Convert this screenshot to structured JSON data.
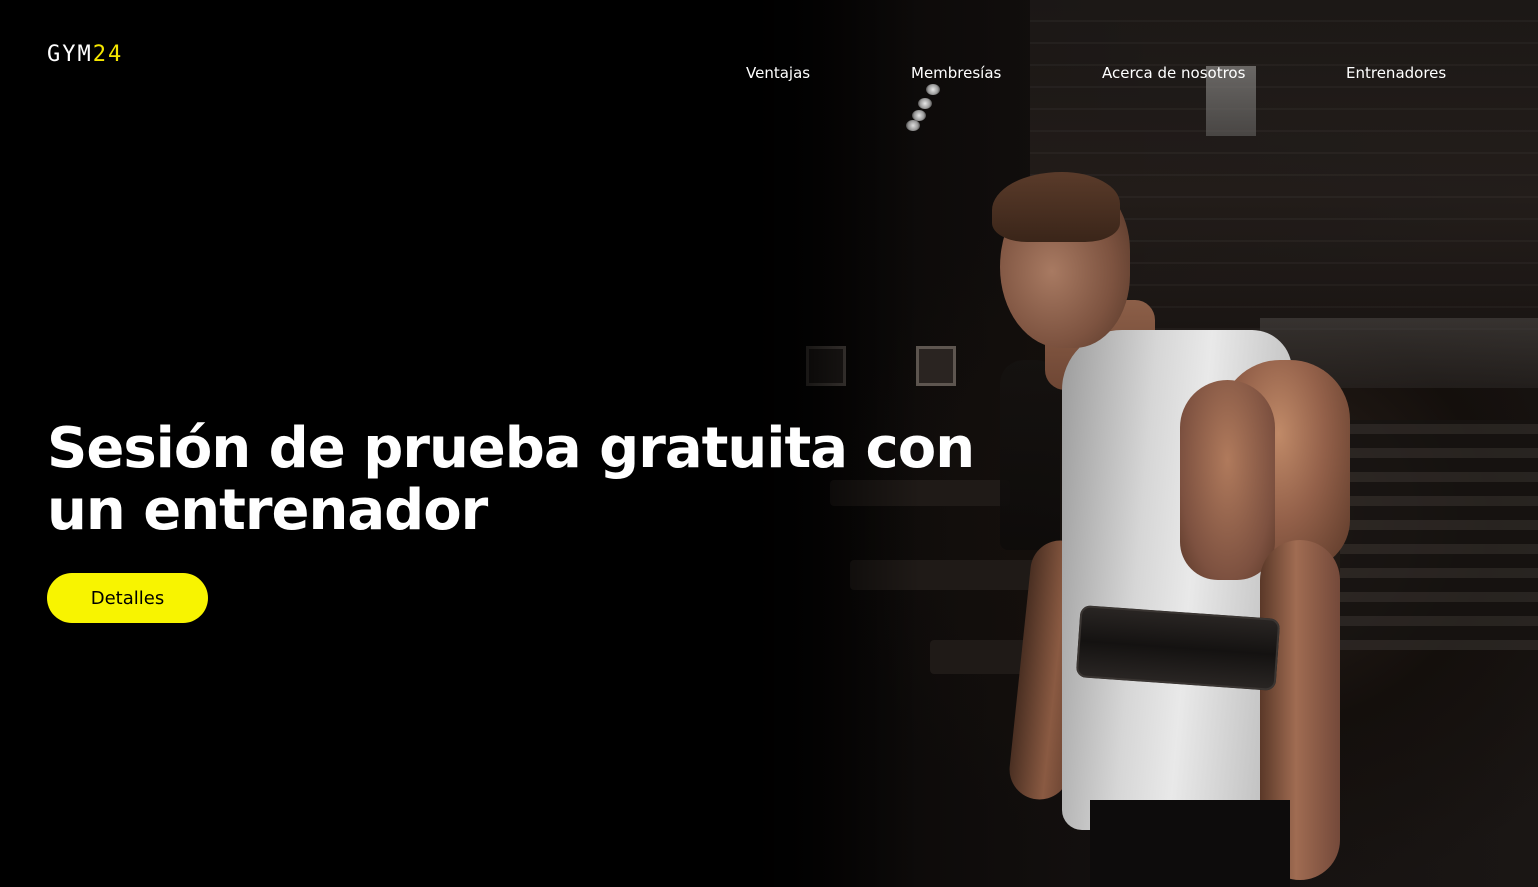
{
  "header": {
    "logo": {
      "main": "GYM",
      "accent": "24"
    },
    "nav": [
      {
        "label": "Ventajas"
      },
      {
        "label": "Membresías"
      },
      {
        "label": "Acerca de nosotros"
      },
      {
        "label": "Entrenadores"
      }
    ]
  },
  "hero": {
    "title": "Sesión de prueba gratuita con un entrenador",
    "cta_label": "Detalles",
    "background_image": "gym-athlete-photo"
  },
  "colors": {
    "background": "#000000",
    "accent": "#f8f400",
    "text": "#ffffff",
    "button_text": "#000000"
  }
}
